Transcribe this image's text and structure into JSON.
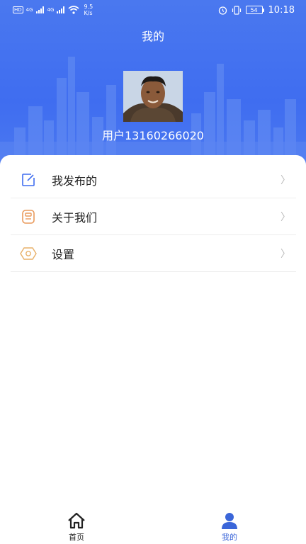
{
  "status_bar": {
    "net_badge": "HD",
    "sig1": "4G",
    "sig2": "4G",
    "speed_value": "9.5",
    "speed_unit": "K/s",
    "battery": "54",
    "time": "10:18"
  },
  "header": {
    "title": "我的",
    "username": "用户13160266020"
  },
  "menu": {
    "items": [
      {
        "label": "我发布的",
        "icon": "edit-icon"
      },
      {
        "label": "关于我们",
        "icon": "info-card-icon"
      },
      {
        "label": "设置",
        "icon": "settings-icon"
      }
    ],
    "chevron": "〉"
  },
  "tabbar": {
    "tabs": [
      {
        "label": "首页",
        "icon": "home-icon",
        "active": false
      },
      {
        "label": "我的",
        "icon": "user-icon",
        "active": true
      }
    ]
  },
  "colors": {
    "header_blue": "#3f6df0",
    "active_tab": "#3b66d9",
    "edit_icon": "#3f6df0",
    "info_icon": "#e99a5c",
    "settings_icon": "#e8b068"
  }
}
